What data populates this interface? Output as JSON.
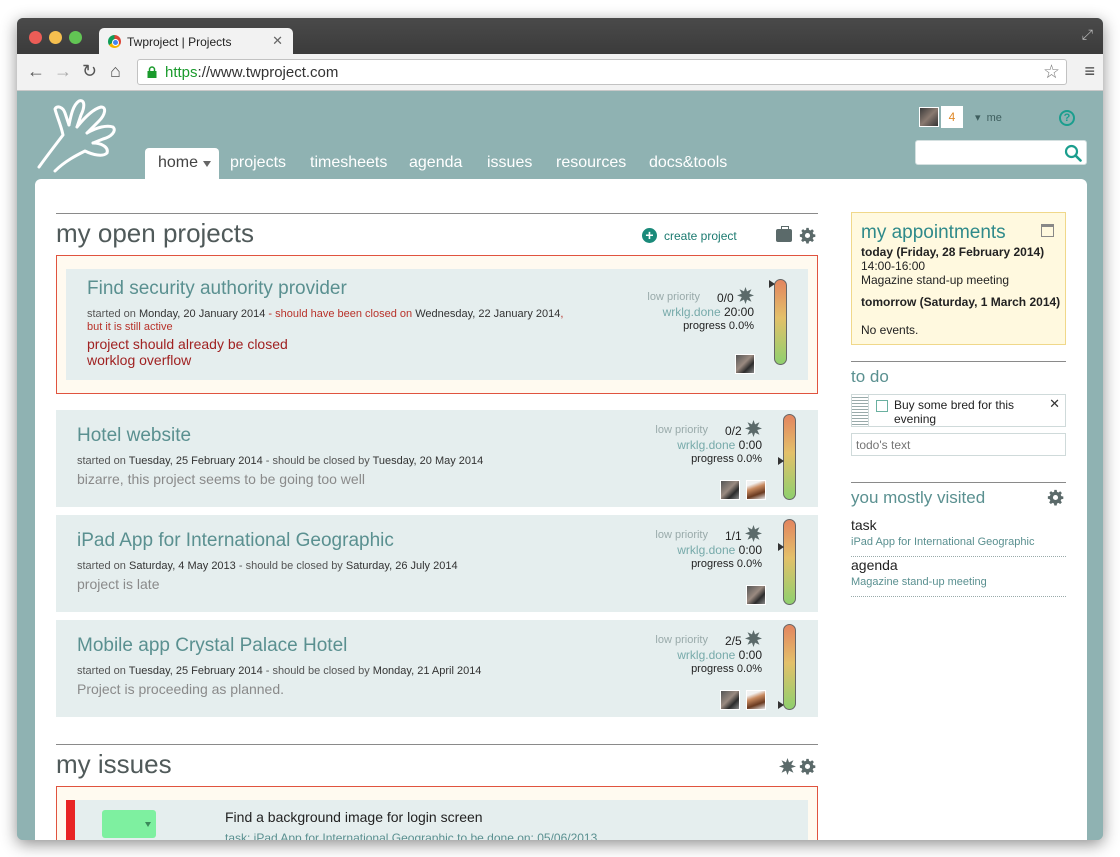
{
  "browser": {
    "tab_title": "Twproject | Projects",
    "url_scheme": "https",
    "url_rest": "://www.twproject.com"
  },
  "header": {
    "count": "4",
    "user": "me",
    "nav": [
      "home",
      "projects",
      "timesheets",
      "agenda",
      "issues",
      "resources",
      "docs&tools"
    ]
  },
  "projects_section": {
    "title": "my open projects",
    "create_label": "create project"
  },
  "projects": [
    {
      "title": "Find security authority provider",
      "started_label": "started on ",
      "start_date": "Monday, 20 January 2014",
      "should_label": " - should have been closed on ",
      "end_date": "Wednesday, 22 January 2014",
      "suffix": ", but it is still active",
      "messages": [
        "project should already be closed",
        "worklog overflow"
      ],
      "priority": "low priority",
      "issues": "0/0",
      "worklog_label": "wrklg.done",
      "worklog": "20:00",
      "progress": "progress 0.0%"
    },
    {
      "title": "Hotel website",
      "started_label": "started on ",
      "start_date": "Tuesday, 25 February 2014",
      "should_label": " - should be closed by ",
      "end_date": "Tuesday, 20 May 2014",
      "message": "bizarre, this project seems to be going too well",
      "priority": "low priority",
      "issues": "0/2",
      "worklog_label": "wrklg.done",
      "worklog": "0:00",
      "progress": "progress 0.0%"
    },
    {
      "title": "iPad App for International Geographic",
      "started_label": "started on ",
      "start_date": "Saturday, 4 May 2013",
      "should_label": " - should be closed by ",
      "end_date": "Saturday, 26 July 2014",
      "message": "project is late",
      "priority": "low priority",
      "issues": "1/1",
      "worklog_label": "wrklg.done",
      "worklog": "0:00",
      "progress": "progress 0.0%"
    },
    {
      "title": "Mobile app Crystal Palace Hotel",
      "started_label": "started on ",
      "start_date": "Tuesday, 25 February 2014",
      "should_label": " - should be closed by ",
      "end_date": "Monday, 21 April 2014",
      "message": "Project is proceeding as planned.",
      "priority": "low priority",
      "issues": "2/5",
      "worklog_label": "wrklg.done",
      "worklog": "0:00",
      "progress": "progress 0.0%"
    }
  ],
  "issues_section": {
    "title": "my issues",
    "issue_title": "Find a background image for login screen",
    "issue_meta": "task: iPad App for International Geographic     to be done on: 05/06/2013"
  },
  "appointments": {
    "title": "my appointments",
    "today": "today (Friday, 28 February 2014)",
    "today_time": "14:00-16:00",
    "today_event": "Magazine stand-up meeting",
    "tomorrow": "tomorrow (Saturday, 1 March 2014)",
    "tomorrow_event": "No events."
  },
  "todo": {
    "title": "to do",
    "item": "Buy some bred for this evening",
    "placeholder": "todo's text"
  },
  "visited": {
    "title": "you mostly visited",
    "items": [
      {
        "type": "task",
        "name": "iPad App for International Geographic"
      },
      {
        "type": "agenda",
        "name": "Magazine stand-up meeting"
      }
    ]
  },
  "colors": {
    "accent": "#8fb2b2",
    "title_teal": "#5a9090",
    "alert_red": "#e0533f"
  }
}
